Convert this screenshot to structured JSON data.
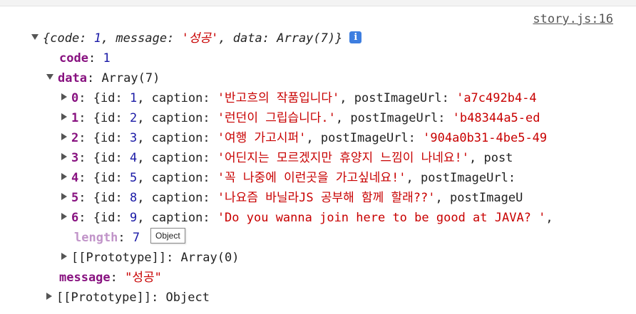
{
  "source_link": "story.js:16",
  "root": {
    "summary_open": "{",
    "summary_code_key": "code",
    "summary_code_val": "1",
    "summary_message_key": "message",
    "summary_message_val": "'성공'",
    "summary_data_key": "data",
    "summary_data_val": "Array(7)",
    "summary_close": "}",
    "info_icon": "i"
  },
  "code": {
    "key": "code",
    "value": "1"
  },
  "data": {
    "key": "data",
    "value": "Array(7)"
  },
  "items": [
    {
      "index": "0",
      "id": "1",
      "caption": "'반고흐의 작품입니다'",
      "url": "'a7c492b4-4"
    },
    {
      "index": "1",
      "id": "2",
      "caption": "'런던이 그립습니다.'",
      "url": "'b48344a5-ed"
    },
    {
      "index": "2",
      "id": "3",
      "caption": "'여행 가고시퍼'",
      "url": "'904a0b31-4be5-49"
    },
    {
      "index": "3",
      "id": "4",
      "caption": "'어딘지는 모르겠지만 휴양지 느낌이 나네요!'",
      "url": ""
    },
    {
      "index": "4",
      "id": "5",
      "caption": "'꼭 나중에 이런곳을 가고싶네요!'",
      "url": ""
    },
    {
      "index": "5",
      "id": "8",
      "caption": "'나요즘 바닐라JS 공부해 함께 할래??'",
      "url": ""
    },
    {
      "index": "6",
      "id": "9",
      "caption": "'Do you wanna join here to be good at JAVA? '",
      "url": ""
    }
  ],
  "item_labels": {
    "id": "id",
    "caption": "caption",
    "url": "postImageUrl",
    "url_short": "post",
    "url_cut": "postImageU"
  },
  "length": {
    "key": "length",
    "value": "7"
  },
  "tooltip": "Object",
  "data_proto": {
    "key": "[[Prototype]]",
    "value": "Array(0)"
  },
  "message": {
    "key": "message",
    "value": "\"성공\""
  },
  "root_proto": {
    "key": "[[Prototype]]",
    "value": "Object"
  }
}
